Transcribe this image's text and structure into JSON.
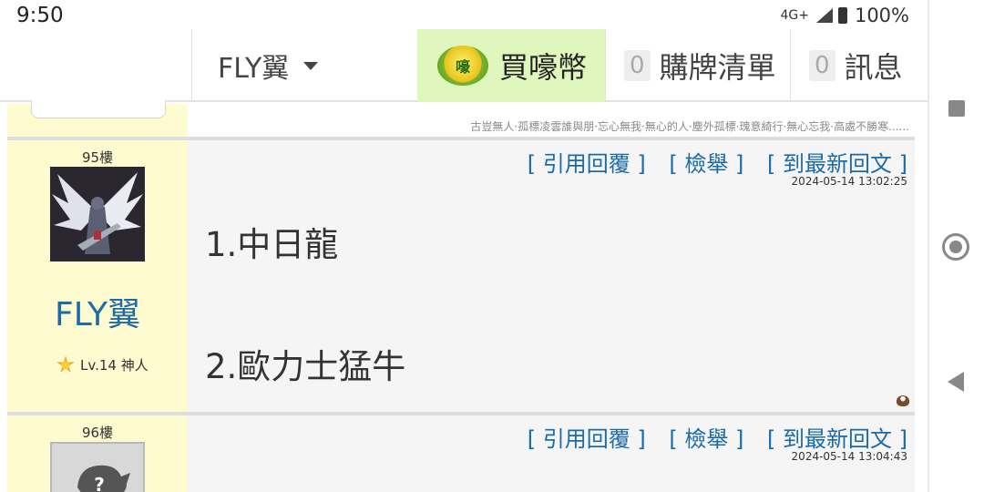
{
  "status_bar": {
    "time": "9:50",
    "network": "4G+",
    "battery": "100%"
  },
  "top_nav": {
    "username": "FLY翼",
    "buy_coin_label": "買嚎幣",
    "coin_glyph": "嚎",
    "shop_list": {
      "count": "0",
      "label": "購牌清單"
    },
    "messages": {
      "count": "0",
      "label": "訊息"
    }
  },
  "prev_signature": "古豈無人·孤標凌雲誰與朋·忘心無我·無心的人·塵外孤標·瑰意綺行·無心忘我·高處不勝寒......",
  "actions": {
    "quote": "[ 引用回覆 ]",
    "report": "[ 檢舉 ]",
    "latest": "[ 到最新回文 ]"
  },
  "posts": [
    {
      "floor": "95樓",
      "username": "FLY翼",
      "level": "Lv.14 神人",
      "timestamp": "2024-05-14 13:02:25",
      "lines": [
        "1.中日龍",
        "2.歐力士猛牛"
      ]
    },
    {
      "floor": "96樓",
      "timestamp": "2024-05-14 13:04:43"
    }
  ],
  "colors": {
    "accent": "#1a6ba8",
    "user_panel": "#fffbd0",
    "buy_coin_bg": "#dff7bd"
  }
}
